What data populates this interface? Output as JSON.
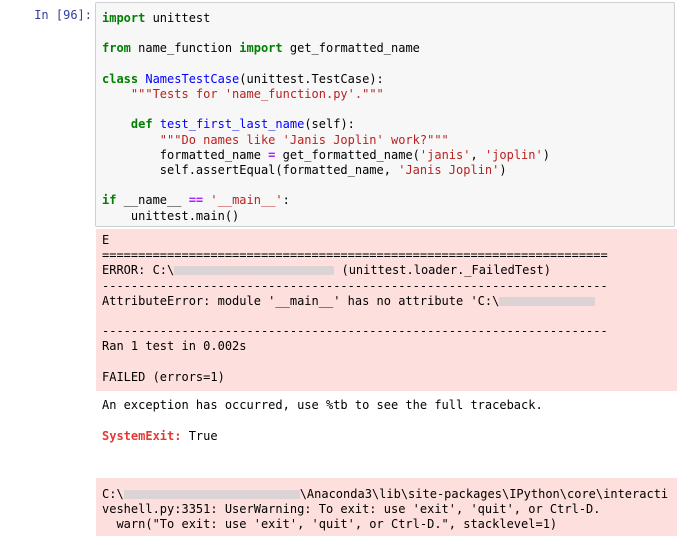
{
  "cell": {
    "prompt": "In [96]:"
  },
  "code": {
    "l1_kw": "import",
    "l1_rest": " unittest",
    "l3_kw1": "from",
    "l3_mod": " name_function ",
    "l3_kw2": "import",
    "l3_rest": " get_formatted_name",
    "l5_kw": "class",
    "l5_name": "NamesTestCase",
    "l5_rest": "(unittest.TestCase):",
    "l6_doc": "\"\"\"Tests for 'name_function.py'.\"\"\"",
    "l8_kw": "def",
    "l8_name": "test_first_last_name",
    "l8_rest": "(self):",
    "l9_doc": "\"\"\"Do names like 'Janis Joplin' work?\"\"\"",
    "l10_a": "formatted_name ",
    "l10_op": "=",
    "l10_b": " get_formatted_name(",
    "l10_s1": "'janis'",
    "l10_c": ", ",
    "l10_s2": "'joplin'",
    "l10_d": ")",
    "l11_a": "self.assertEqual(formatted_name, ",
    "l11_s": "'Janis Joplin'",
    "l11_b": ")",
    "l13_kw": "if",
    "l13_a": " __name__ ",
    "l13_op": "==",
    "l13_sp": " ",
    "l13_s": "'__main__'",
    "l13_b": ":",
    "l14": "unittest.main()"
  },
  "stderr1": {
    "l1": "E",
    "l2": "======================================================================",
    "l3_a": "ERROR: C:\\",
    "l3_b": " (unittest.loader._FailedTest)",
    "l4": "----------------------------------------------------------------------",
    "l5": "AttributeError: module '__main__' has no attribute 'C:\\",
    "l7": "----------------------------------------------------------------------",
    "l8": "Ran 1 test in 0.002s",
    "l10": "FAILED (errors=1)"
  },
  "traceback_msg": "An exception has occurred, use %tb to see the full traceback.",
  "system_exit": {
    "name": "SystemExit:",
    "value": " True"
  },
  "stderr2": {
    "l1_a": "C:\\",
    "l1_b": "\\Anaconda3\\lib\\site-packages\\IPython\\core\\interacti",
    "l2": "veshell.py:3351: UserWarning: To exit: use 'exit', 'quit', or Ctrl-D.",
    "l3": "  warn(\"To exit: use 'exit', 'quit', or Ctrl-D.\", stacklevel=1)"
  }
}
